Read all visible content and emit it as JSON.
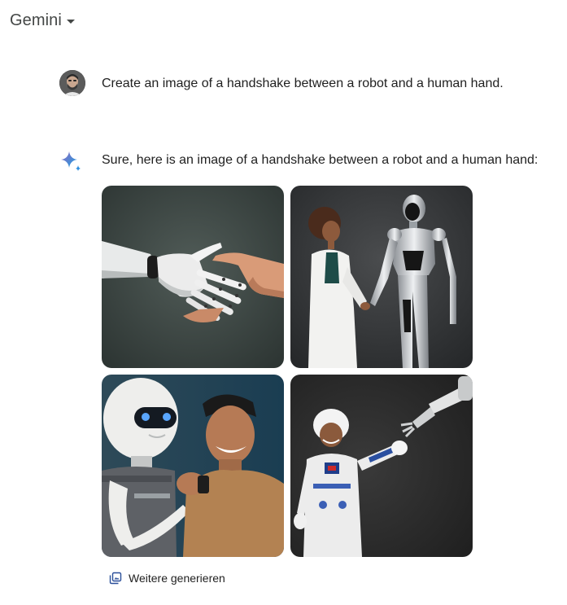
{
  "header": {
    "app_title": "Gemini"
  },
  "conversation": {
    "user_prompt": "Create an image of a handshake between a robot and a human hand.",
    "assistant_reply": "Sure, here is an image of a handshake between a robot and a human hand:",
    "images": [
      {
        "alt": "Robot hand shaking a human hand"
      },
      {
        "alt": "Woman in white coat shaking hands with a silver humanoid robot"
      },
      {
        "alt": "Smiling man shaking hands with a white robot"
      },
      {
        "alt": "Astronaut reaching toward a robotic arm"
      }
    ]
  },
  "actions": {
    "generate_more_label": "Weitere generieren"
  },
  "colors": {
    "accent_blue": "#4c8df6",
    "text": "#1f1f1f",
    "muted": "#444746"
  }
}
